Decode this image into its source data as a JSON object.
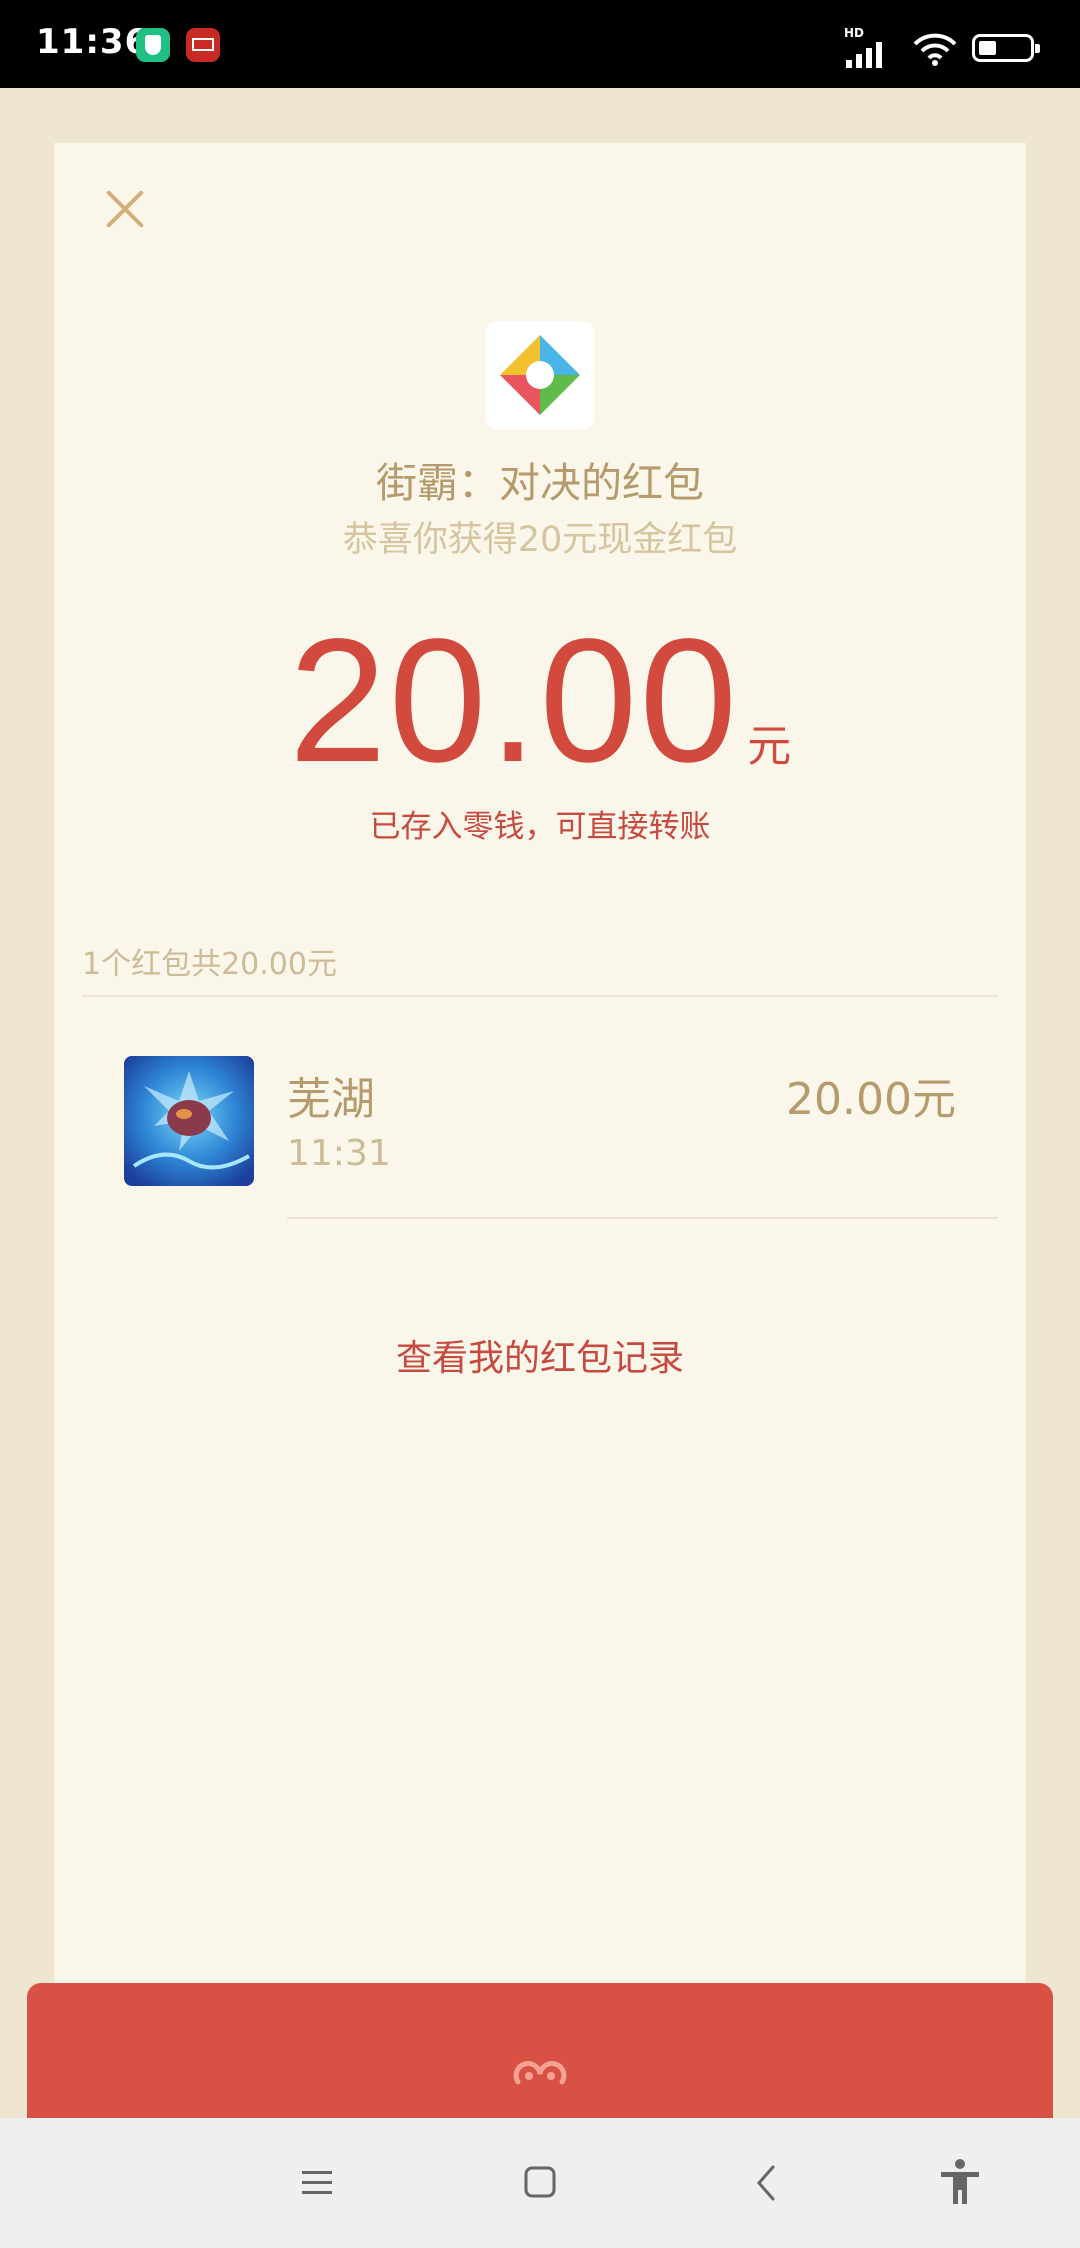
{
  "status_bar": {
    "time": "11:36",
    "network_label": "HD",
    "app_icons": [
      "shield-app-icon",
      "jieba-app-icon"
    ],
    "battery_level": 0.35
  },
  "card": {
    "close_icon": "close-icon",
    "logo_icon": "game-logo-icon",
    "sender_title": "街霸：对决的红包",
    "subtitle": "恭喜你获得20元现金红包",
    "amount": "20.00",
    "amount_unit": "元",
    "stored_note": "已存入零钱，可直接转账",
    "summary": "1个红包共20.00元",
    "records": [
      {
        "avatar_icon": "dragon-avatar",
        "name": "芜湖",
        "time": "11:31",
        "amount": "20.00元"
      }
    ],
    "history_link": "查看我的红包记录"
  },
  "colors": {
    "accent_red": "#d2493e",
    "gold_text": "#b59a6c",
    "card_bg": "#fbf6ea",
    "page_bg": "#efe6d2"
  },
  "nav_bar": {
    "buttons": [
      "menu-icon",
      "home-icon",
      "back-icon",
      "accessibility-icon"
    ]
  }
}
